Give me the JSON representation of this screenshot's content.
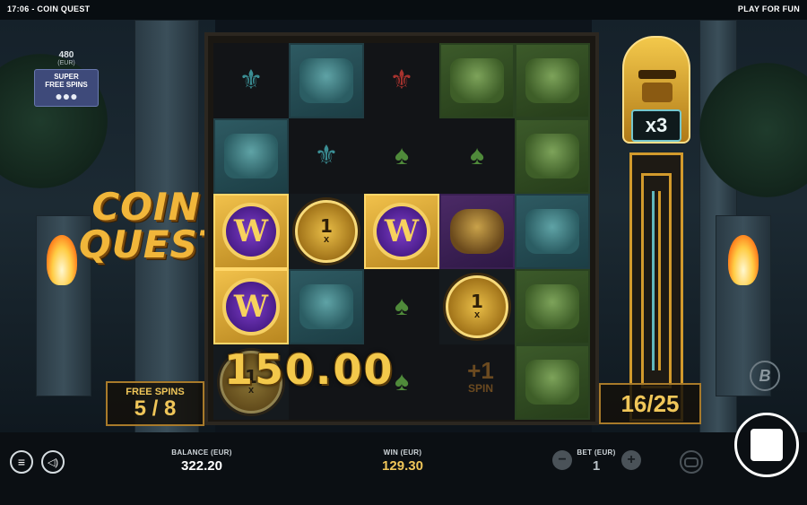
{
  "topbar": {
    "time_title": "17:06 - COIN QUEST",
    "mode": "PLAY FOR FUN"
  },
  "super_free_spins": {
    "price": "480",
    "currency": "(EUR)",
    "label_line1": "SUPER",
    "label_line2": "FREE SPINS"
  },
  "logo": {
    "line1": "COIN",
    "line2": "QUEST"
  },
  "free_spins_panel": {
    "label": "FREE SPINS",
    "value": "5 / 8"
  },
  "multiplier": {
    "value": "x3"
  },
  "spin_counter": {
    "value": "16/25"
  },
  "win_display": {
    "amount": "150.00"
  },
  "plus_spin": {
    "plus": "+1",
    "label": "SPIN"
  },
  "reels": {
    "rows": [
      [
        "suit-teal",
        "frog",
        "suit-red",
        "monkey",
        "monkey"
      ],
      [
        "frog",
        "suit-teal",
        "suit-green",
        "suit-green",
        "monkey"
      ],
      [
        "w",
        "coin",
        "w",
        "skull",
        "frog"
      ],
      [
        "w",
        "frog",
        "suit-green",
        "coin",
        "monkey"
      ],
      [
        "coin-dim",
        "blank",
        "suit-green",
        "plus-spin",
        "monkey"
      ]
    ],
    "coin_value": "1",
    "coin_mult": "x",
    "w_letter": "W"
  },
  "bottom": {
    "balance_label": "BALANCE (EUR)",
    "balance_value": "322.20",
    "win_label": "WIN (EUR)",
    "win_value": "129.30",
    "bet_label": "BET (EUR)",
    "bet_value": "1"
  },
  "icons": [
    "menu-icon",
    "sound-icon",
    "minus-icon",
    "plus-icon",
    "autoplay-icon",
    "stop-icon",
    "brand-b-icon"
  ],
  "colors": {
    "gold": "#f3c84b",
    "win_gold": "#f0c659",
    "teal": "#74c6cc",
    "purple": "#5a2a9a"
  }
}
